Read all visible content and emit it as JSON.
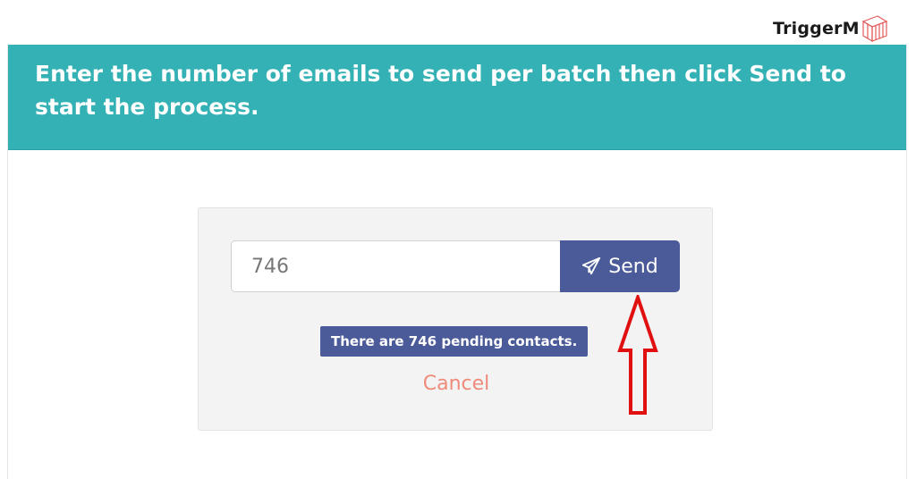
{
  "brand": {
    "name": "TriggerM",
    "accent_color": "#e35a5a"
  },
  "panel": {
    "title": "Enter the number of emails to send per batch then click Send to start the process.",
    "header_color": "#33b1b5"
  },
  "form": {
    "batch_size_value": "746",
    "send_label": "Send",
    "send_icon": "paper-plane-icon",
    "pending_message": "There are 746 pending contacts.",
    "cancel_label": "Cancel",
    "button_color": "#4b5b99",
    "cancel_color": "#f08a7a"
  },
  "annotation": {
    "arrow_color": "#e01010",
    "direction": "up"
  }
}
